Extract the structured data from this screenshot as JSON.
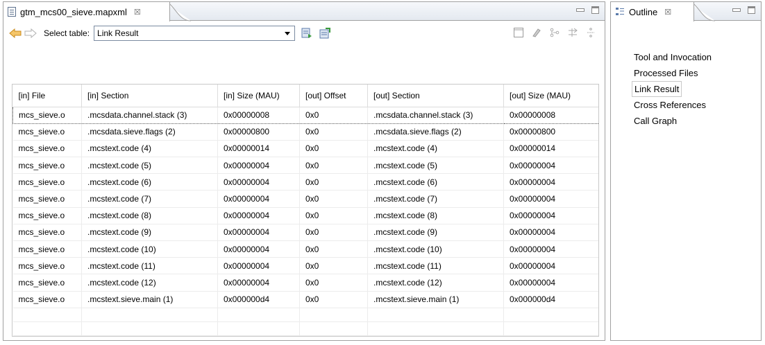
{
  "editor": {
    "tab_title": "gtm_mcs00_sieve.mapxml",
    "close_glyph": "☒"
  },
  "toolbar": {
    "select_label": "Select table:",
    "select_value": "Link Result"
  },
  "table": {
    "headers": [
      "[in] File",
      "[in] Section",
      "[in] Size (MAU)",
      "[out] Offset",
      "[out] Section",
      "[out] Size (MAU)"
    ],
    "rows": [
      [
        "mcs_sieve.o",
        ".mcsdata.channel.stack (3)",
        "0x00000008",
        "0x0",
        ".mcsdata.channel.stack (3)",
        "0x00000008"
      ],
      [
        "mcs_sieve.o",
        ".mcsdata.sieve.flags (2)",
        "0x00000800",
        "0x0",
        ".mcsdata.sieve.flags (2)",
        "0x00000800"
      ],
      [
        "mcs_sieve.o",
        ".mcstext.code (4)",
        "0x00000014",
        "0x0",
        ".mcstext.code (4)",
        "0x00000014"
      ],
      [
        "mcs_sieve.o",
        ".mcstext.code (5)",
        "0x00000004",
        "0x0",
        ".mcstext.code (5)",
        "0x00000004"
      ],
      [
        "mcs_sieve.o",
        ".mcstext.code (6)",
        "0x00000004",
        "0x0",
        ".mcstext.code (6)",
        "0x00000004"
      ],
      [
        "mcs_sieve.o",
        ".mcstext.code (7)",
        "0x00000004",
        "0x0",
        ".mcstext.code (7)",
        "0x00000004"
      ],
      [
        "mcs_sieve.o",
        ".mcstext.code (8)",
        "0x00000004",
        "0x0",
        ".mcstext.code (8)",
        "0x00000004"
      ],
      [
        "mcs_sieve.o",
        ".mcstext.code (9)",
        "0x00000004",
        "0x0",
        ".mcstext.code (9)",
        "0x00000004"
      ],
      [
        "mcs_sieve.o",
        ".mcstext.code (10)",
        "0x00000004",
        "0x0",
        ".mcstext.code (10)",
        "0x00000004"
      ],
      [
        "mcs_sieve.o",
        ".mcstext.code (11)",
        "0x00000004",
        "0x0",
        ".mcstext.code (11)",
        "0x00000004"
      ],
      [
        "mcs_sieve.o",
        ".mcstext.code (12)",
        "0x00000004",
        "0x0",
        ".mcstext.code (12)",
        "0x00000004"
      ],
      [
        "mcs_sieve.o",
        ".mcstext.sieve.main (1)",
        "0x000000d4",
        "0x0",
        ".mcstext.sieve.main (1)",
        "0x000000d4"
      ]
    ]
  },
  "outline": {
    "tab_title": "Outline",
    "close_glyph": "☒",
    "items": [
      "Tool and Invocation",
      "Processed Files",
      "Link Result",
      "Cross References",
      "Call Graph"
    ],
    "selected": "Link Result"
  },
  "icons": {
    "back": "back-arrow-icon",
    "forward": "forward-arrow-icon"
  },
  "colors": {
    "accent": "#e8a33a",
    "border": "#a0a0a0"
  }
}
